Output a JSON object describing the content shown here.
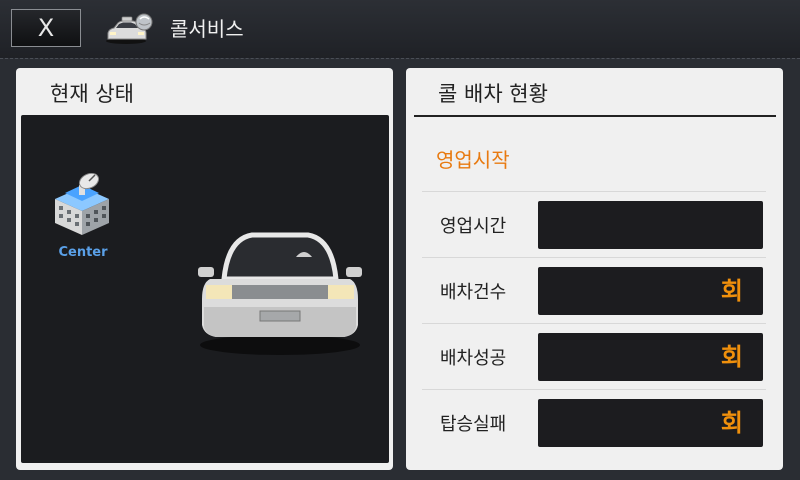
{
  "header": {
    "close_label": "X",
    "app_icon": "call-taxi-icon",
    "title": "콜서비스"
  },
  "status_panel": {
    "title": "현재 상태",
    "center_icon": "center-building-satellite-icon",
    "center_label": "Center",
    "vehicle_icon": "taxi-car-icon"
  },
  "dispatch_panel": {
    "title": "콜 배차 현황",
    "status_text": "영업시작",
    "rows": [
      {
        "label": "영업시간",
        "value": ""
      },
      {
        "label": "배차건수",
        "value": "회"
      },
      {
        "label": "배차성공",
        "value": "회"
      },
      {
        "label": "탑승실패",
        "value": "회"
      }
    ]
  },
  "colors": {
    "accent": "#f0900c",
    "status": "#e87a10",
    "center_label": "#5aa0e8"
  }
}
